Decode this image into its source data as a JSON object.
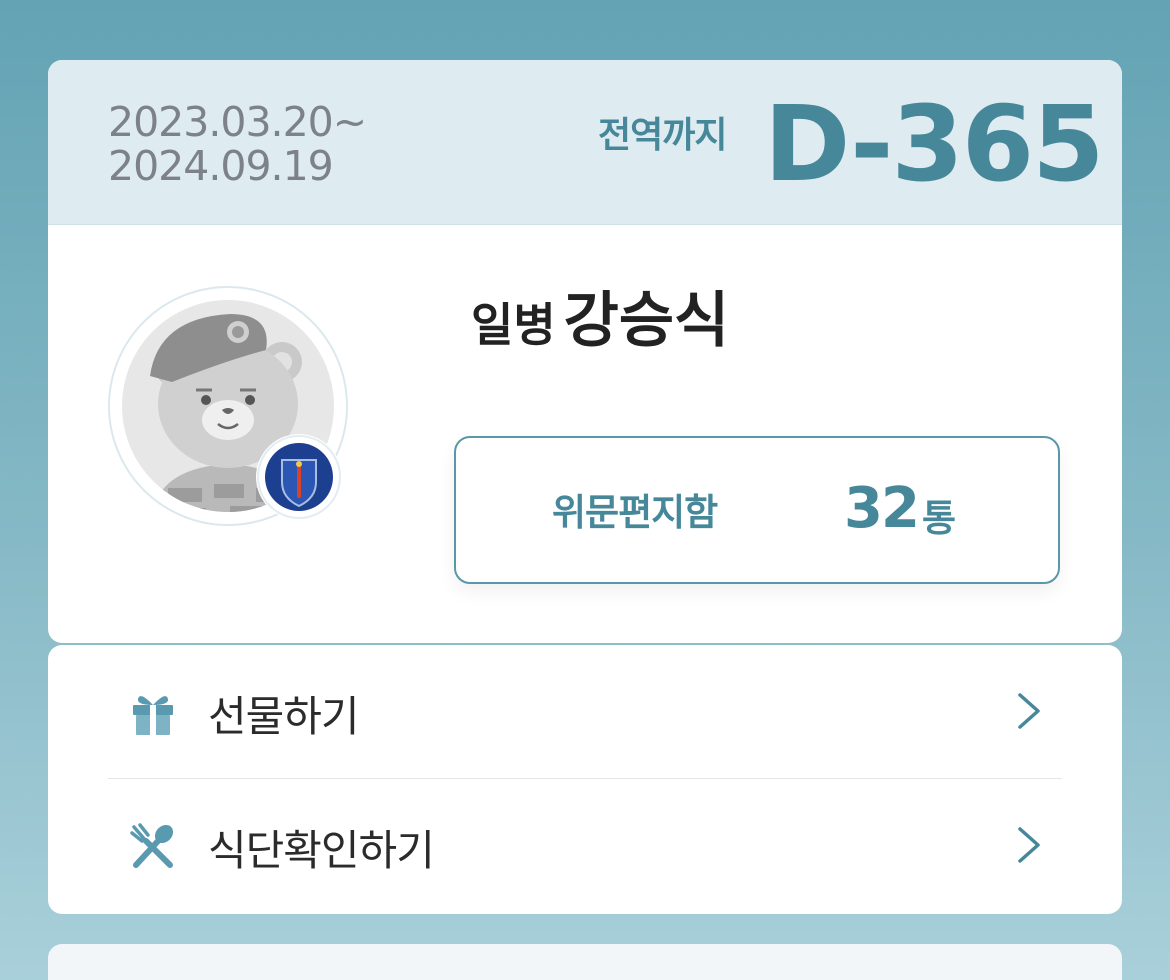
{
  "service": {
    "start_date": "2023.03.20~",
    "end_date": "2024.09.19",
    "dday_label": "전역까지",
    "dday_value": "D-365"
  },
  "profile": {
    "rank": "일병",
    "name": "강승식",
    "avatar": "bear-soldier-avatar",
    "badge": "army-unit-badge-icon"
  },
  "mailbox": {
    "label": "위문편지함",
    "count": "32",
    "unit": "통"
  },
  "menu": {
    "items": [
      {
        "label": "선물하기",
        "icon": "gift-icon"
      },
      {
        "label": "식단확인하기",
        "icon": "fork-knife-icon"
      }
    ]
  },
  "colors": {
    "accent": "#46879a",
    "header_bg": "#deebf0",
    "background_top": "#63a3b4",
    "background_bottom": "#a9d0da"
  }
}
